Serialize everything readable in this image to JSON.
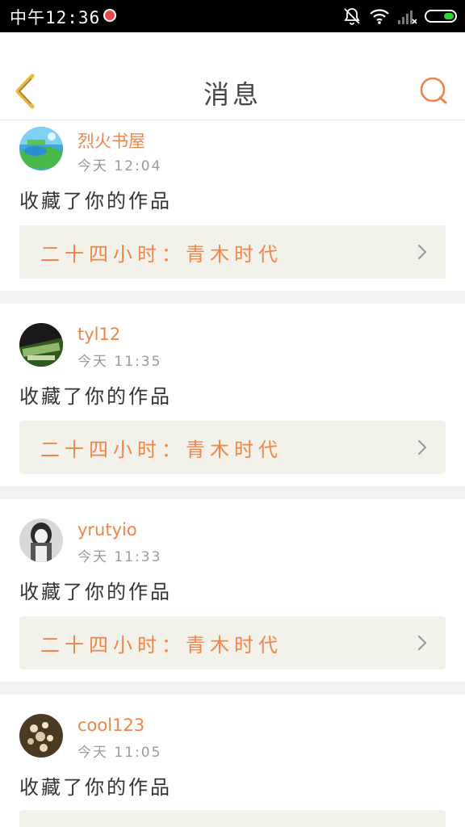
{
  "status_bar": {
    "time": "中午12:36",
    "icons": [
      "notifications-off-icon",
      "wifi-icon",
      "signal-icon",
      "battery-icon"
    ],
    "battery_color": "#32d232"
  },
  "header": {
    "title": "消息",
    "back_icon": "chevron-left-icon",
    "search_icon": "search-icon",
    "back_color": "#e8b93a",
    "search_color": "#f0854a"
  },
  "messages": [
    {
      "username": "烈火书屋",
      "time": "今天 12:04",
      "action": "收藏了你的作品",
      "work_title": "二十四小时：青木时代"
    },
    {
      "username": "tyl12",
      "time": "今天 11:35",
      "action": "收藏了你的作品",
      "work_title": "二十四小时：青木时代"
    },
    {
      "username": "yrutyio",
      "time": "今天 11:33",
      "action": "收藏了你的作品",
      "work_title": "二十四小时：青木时代"
    },
    {
      "username": "cool123",
      "time": "今天 11:05",
      "action": "收藏了你的作品",
      "work_title": ""
    }
  ],
  "colors": {
    "accent": "#f0854a",
    "link_bg": "#f2f1ea",
    "divider": "#f2f2f2"
  }
}
